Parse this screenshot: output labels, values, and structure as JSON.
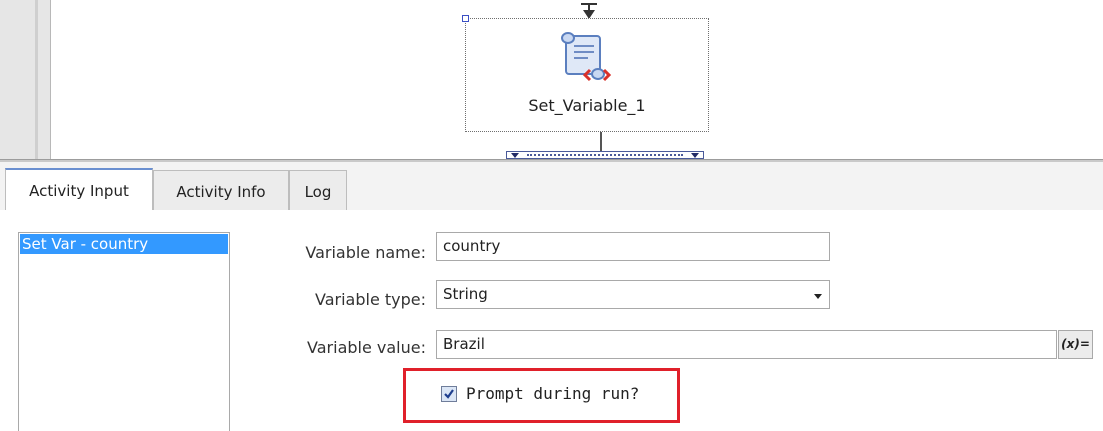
{
  "canvas": {
    "node_label": "Set_Variable_1",
    "node_icon": "script-scroll-icon"
  },
  "tabs": [
    {
      "label": "Activity Input",
      "active": true
    },
    {
      "label": "Activity Info",
      "active": false
    },
    {
      "label": "Log",
      "active": false
    }
  ],
  "activity_list": {
    "items": [
      {
        "label": "Set Var - country",
        "selected": true
      }
    ]
  },
  "form": {
    "variable_name": {
      "label": "Variable name:",
      "value": "country"
    },
    "variable_type": {
      "label": "Variable type:",
      "value": "String"
    },
    "variable_value": {
      "label": "Variable value:",
      "value": "Brazil"
    },
    "expression_button": {
      "label": "(x)="
    },
    "prompt_checkbox": {
      "label": "Prompt during run?",
      "checked": true
    }
  },
  "colors": {
    "selection": "#3399ff",
    "highlight_border": "#e0202a",
    "active_tab_accent": "#6a8fd0"
  }
}
